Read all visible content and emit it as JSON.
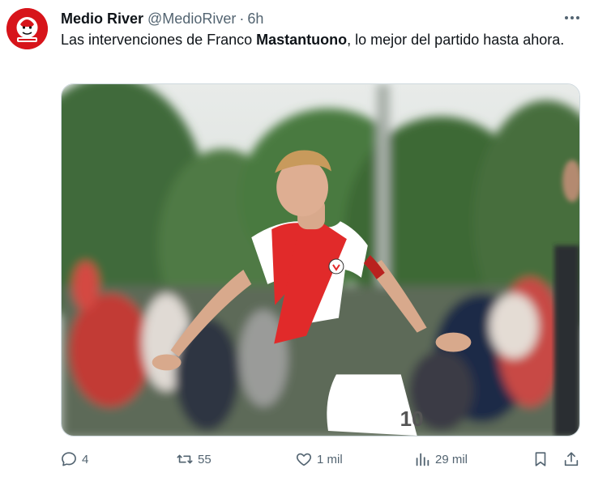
{
  "tweet": {
    "author_name": "Medio River",
    "author_handle": "@MedioRiver",
    "separator": "·",
    "time": "6h",
    "text_before": "Las intervenciones de Franco ",
    "text_bold": "Mastantuono",
    "text_after": ", lo mejor del partido hasta ahora.",
    "image_jersey_number": "10"
  },
  "actions": {
    "replies": "4",
    "reposts": "55",
    "likes": "1 mil",
    "views": "29 mil"
  },
  "icons": {
    "more": "more-horizontal-icon",
    "reply": "reply-icon",
    "repost": "repost-icon",
    "like": "heart-icon",
    "views": "views-chart-icon",
    "bookmark": "bookmark-icon",
    "share": "share-icon"
  },
  "colors": {
    "text_primary": "#0f1419",
    "text_secondary": "#536471",
    "avatar_red": "#d7141a"
  }
}
